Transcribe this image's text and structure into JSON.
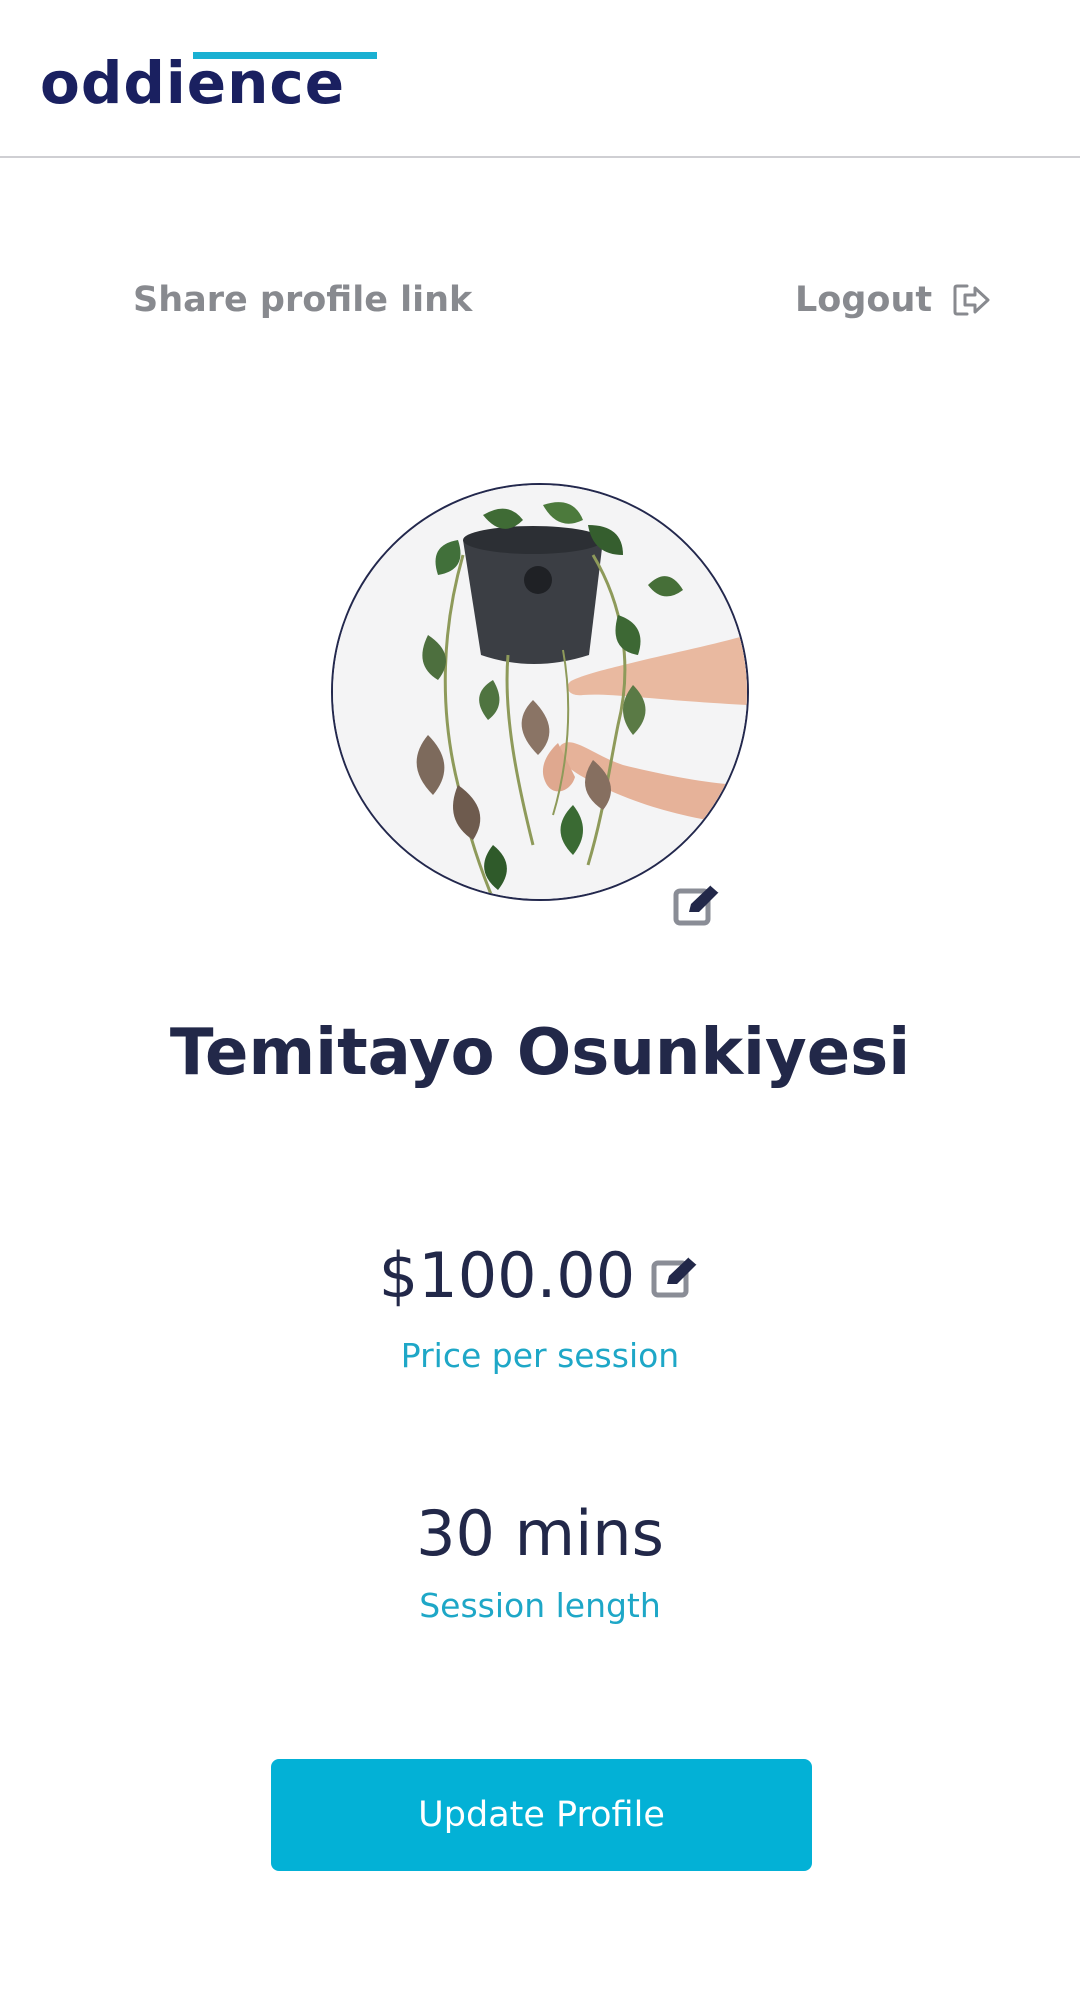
{
  "brand": {
    "logo_text": "oddience"
  },
  "colors": {
    "navy": "#222849",
    "accent": "#03b1d6",
    "caption": "#1ea7c7",
    "muted": "#888a8f"
  },
  "top_actions": {
    "share_label": "Share profile link",
    "logout_label": "Logout"
  },
  "profile": {
    "photo_subject": "hands holding a trailing potted plant",
    "name": "Temitayo Osunkiyesi",
    "price": "$100.00",
    "price_caption": "Price per session",
    "session_length": "30 mins",
    "session_caption": "Session length"
  },
  "icons": {
    "logout": "logout-icon",
    "avatar_edit": "edit-icon",
    "price_edit": "edit-icon"
  },
  "actions": {
    "update_label": "Update Profile"
  }
}
